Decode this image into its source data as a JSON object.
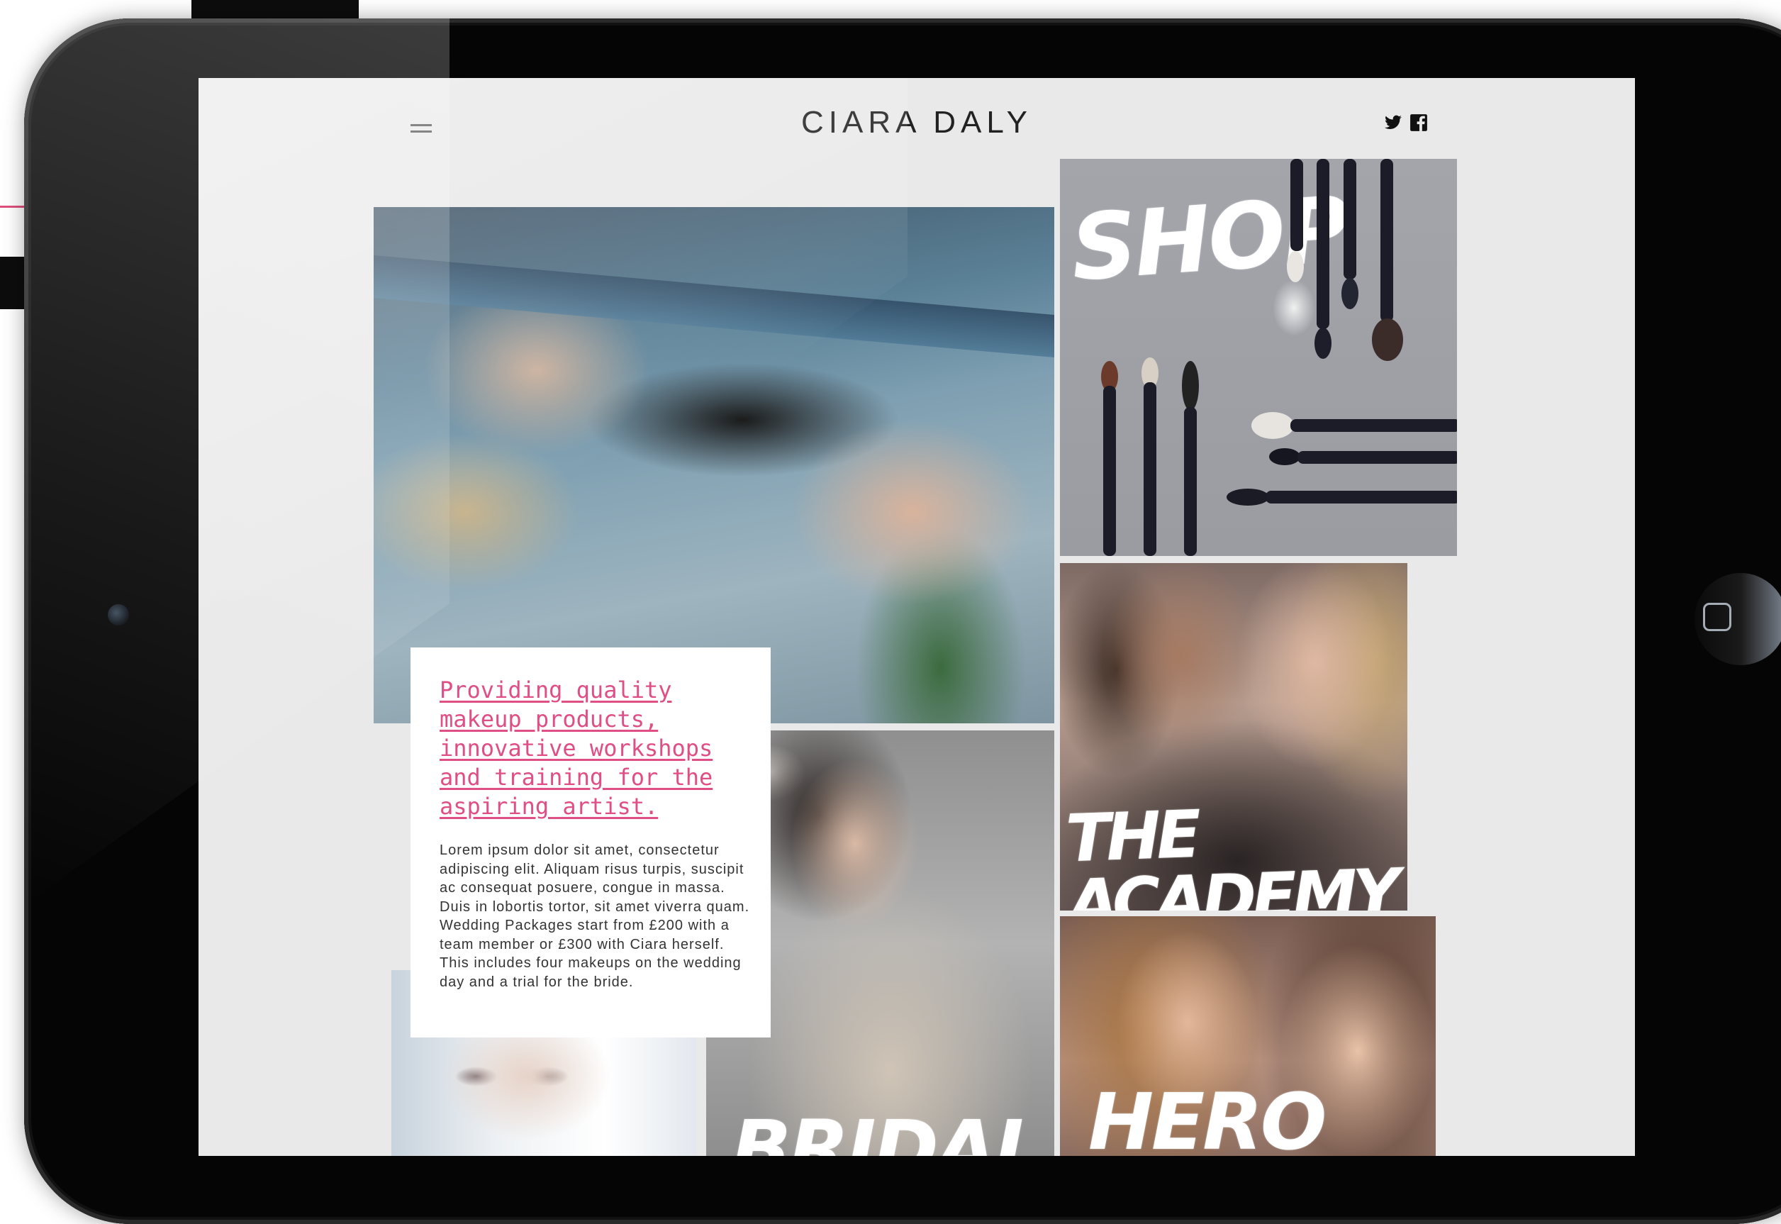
{
  "site": {
    "title": "CIARA DALY",
    "menu_icon": "hamburger-menu-icon",
    "social": [
      {
        "name": "twitter",
        "icon": "twitter-icon"
      },
      {
        "name": "facebook",
        "icon": "facebook-icon"
      }
    ]
  },
  "intro": {
    "headline": "Providing quality makeup products, innovative workshops and training for the aspiring artist.",
    "body": "Lorem ipsum dolor sit amet, consectetur adipiscing elit. Aliquam risus turpis, suscipit ac consequat posuere, congue in massa. Duis in lobortis tortor, sit amet viverra quam. Wedding Packages start from £200 with a team member  or £300 with Ciara herself. This includes four makeups on the wedding day and a trial for the bride."
  },
  "tiles": {
    "shop": "SHOP",
    "academy": "THE ACADEMY",
    "bridal": "BRIDAL",
    "hero": "HERO"
  },
  "colors": {
    "accent_pink": "#e04e86",
    "screen_bg": "#e9e9e9",
    "device": "#050505"
  }
}
